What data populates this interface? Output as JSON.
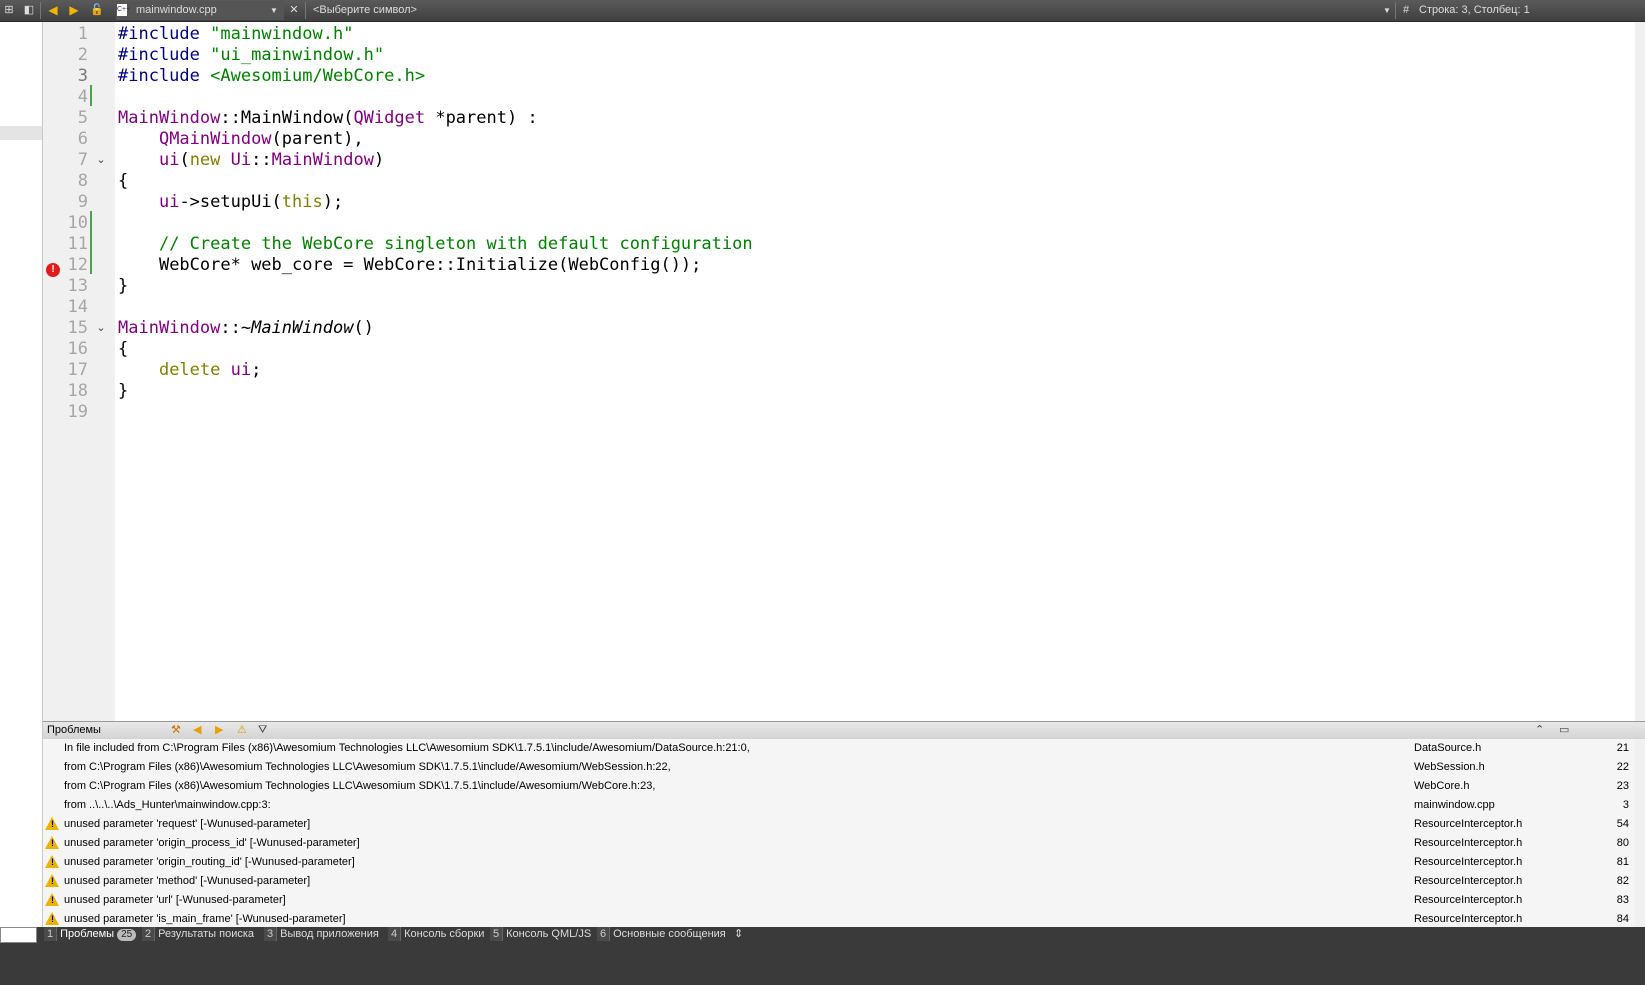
{
  "toolbar": {
    "file_name": "mainwindow.cpp",
    "symbol_placeholder": "<Выберите символ>",
    "position": "Строка: 3, Столбец: 1",
    "position_prefix": "#"
  },
  "editor": {
    "lines": [
      {
        "n": "1"
      },
      {
        "n": "2"
      },
      {
        "n": "3"
      },
      {
        "n": "4"
      },
      {
        "n": "5"
      },
      {
        "n": "6"
      },
      {
        "n": "7"
      },
      {
        "n": "8"
      },
      {
        "n": "9"
      },
      {
        "n": "10"
      },
      {
        "n": "11"
      },
      {
        "n": "12"
      },
      {
        "n": "13"
      },
      {
        "n": "14"
      },
      {
        "n": "15"
      },
      {
        "n": "16"
      },
      {
        "n": "17"
      },
      {
        "n": "18"
      },
      {
        "n": "19"
      }
    ],
    "code": {
      "l1_pp": "#include",
      "l1_str": "\"mainwindow.h\"",
      "l2_pp": "#include",
      "l2_str": "\"ui_mainwindow.h\"",
      "l3_pp": "#include",
      "l3_str": "<Awesomium/WebCore.h>",
      "l5_cls": "MainWindow",
      "l5_sep": "::",
      "l5_fn": "MainWindow(",
      "l5_ty": "QWidget",
      "l5_rest": " *parent) :",
      "l6_ty": "QMainWindow",
      "l6_rest": "(parent),",
      "l7_ui": "ui",
      "l7_p": "(",
      "l7_new": "new",
      "l7_sp": " ",
      "l7_ui2": "Ui",
      "l7_sep": "::",
      "l7_ty": "MainWindow",
      "l7_close": ")",
      "l8": "{",
      "l9_ui": "ui",
      "l9_mid": "->setupUi(",
      "l9_this": "this",
      "l9_end": ");",
      "l11": "// Create the WebCore singleton with default configuration",
      "l12": "WebCore* web_core = WebCore::Initialize(WebConfig());",
      "l13": "}",
      "l15_cls": "MainWindow",
      "l15_sep": "::~",
      "l15_fn": "MainWindow",
      "l15_end": "()",
      "l16": "{",
      "l17_del": "delete",
      "l17_sp": " ",
      "l17_ui": "ui",
      "l17_end": ";",
      "l18": "}"
    }
  },
  "problems": {
    "title": "Проблемы",
    "rows": [
      {
        "icon": "",
        "desc": "In file included from C:\\Program Files (x86)\\Awesomium Technologies LLC\\Awesomium SDK\\1.7.5.1\\include/Awesomium/DataSource.h:21:0,",
        "file": "DataSource.h",
        "line": "21"
      },
      {
        "icon": "",
        "desc": "from C:\\Program Files (x86)\\Awesomium Technologies LLC\\Awesomium SDK\\1.7.5.1\\include/Awesomium/WebSession.h:22,",
        "file": "WebSession.h",
        "line": "22"
      },
      {
        "icon": "",
        "desc": "from C:\\Program Files (x86)\\Awesomium Technologies LLC\\Awesomium SDK\\1.7.5.1\\include/Awesomium/WebCore.h:23,",
        "file": "WebCore.h",
        "line": "23"
      },
      {
        "icon": "",
        "desc": "from ..\\..\\..\\Ads_Hunter\\mainwindow.cpp:3:",
        "file": "mainwindow.cpp",
        "line": "3"
      },
      {
        "icon": "warning-icon",
        "desc": "unused parameter 'request' [-Wunused-parameter]",
        "file": "ResourceInterceptor.h",
        "line": "54"
      },
      {
        "icon": "warning-icon",
        "desc": "unused parameter 'origin_process_id' [-Wunused-parameter]",
        "file": "ResourceInterceptor.h",
        "line": "80"
      },
      {
        "icon": "warning-icon",
        "desc": "unused parameter 'origin_routing_id' [-Wunused-parameter]",
        "file": "ResourceInterceptor.h",
        "line": "81"
      },
      {
        "icon": "warning-icon",
        "desc": "unused parameter 'method' [-Wunused-parameter]",
        "file": "ResourceInterceptor.h",
        "line": "82"
      },
      {
        "icon": "warning-icon",
        "desc": "unused parameter 'url' [-Wunused-parameter]",
        "file": "ResourceInterceptor.h",
        "line": "83"
      },
      {
        "icon": "warning-icon",
        "desc": "unused parameter 'is_main_frame' [-Wunused-parameter]",
        "file": "ResourceInterceptor.h",
        "line": "84"
      }
    ]
  },
  "bottom_tabs": [
    {
      "num": "1",
      "label": "Проблемы",
      "badge": "25"
    },
    {
      "num": "2",
      "label": "Результаты поиска"
    },
    {
      "num": "3",
      "label": "Вывод приложения"
    },
    {
      "num": "4",
      "label": "Консоль сборки"
    },
    {
      "num": "5",
      "label": "Консоль QML/JS"
    },
    {
      "num": "6",
      "label": "Основные сообщения"
    }
  ],
  "colors": {
    "keyword": "#808000",
    "preprocessor": "#000080",
    "string": "#008000",
    "type": "#800080",
    "warning": "#e8b400",
    "error": "#e01b1b"
  }
}
